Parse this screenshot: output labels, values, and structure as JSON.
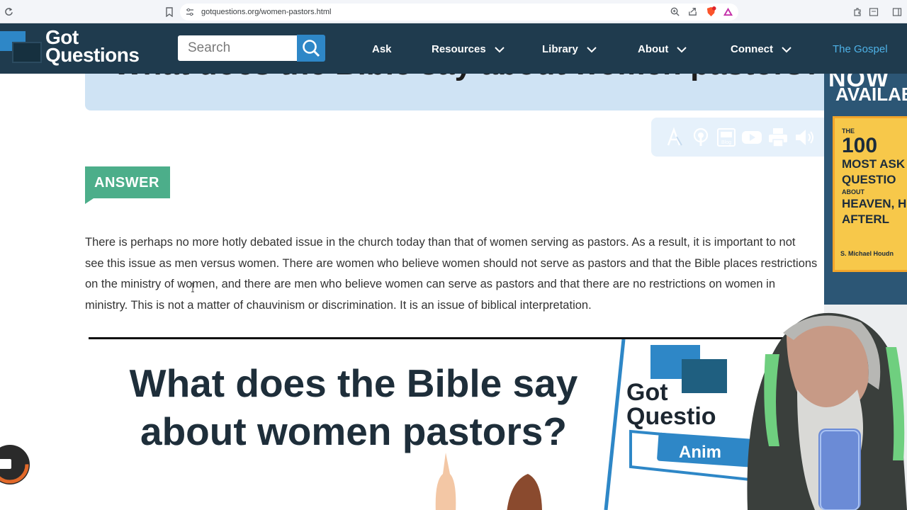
{
  "browser": {
    "url": "gotquestions.org/women-pastors.html"
  },
  "nav": {
    "logo_line1": "Got",
    "logo_line2": "Questions",
    "search_placeholder": "Search",
    "items": [
      {
        "label": "Ask"
      },
      {
        "label": "Resources"
      },
      {
        "label": "Library"
      },
      {
        "label": "About"
      },
      {
        "label": "Connect"
      }
    ],
    "gospel_label": "The Gospel"
  },
  "article": {
    "title": "What does the Bible say about women pastors?",
    "answer_label": "ANSWER",
    "paragraph_lines": [
      "There is perhaps no more hotly debated issue in the church today than that of women serving as pastors. As a result, it is important to not",
      "see this issue as men versus women. There are women who believe women should not serve as pastors and that the Bible places restrictions",
      "on the ministry of women, and there are men who believe women can serve as pastors and that there are no restrictions on women in",
      "ministry. This is not a matter of chauvinism or discrimination. It is an issue of biblical interpretation."
    ]
  },
  "video": {
    "title_line1": "What does the Bible say",
    "title_line2": "about women pastors?",
    "brand_line1": "Got",
    "brand_line2": "Questio",
    "banner": "Anim"
  },
  "ad": {
    "now": "NOW",
    "available": "AVAILAB",
    "book_line1": "THE",
    "book_line2": "100",
    "book_line3": "MOST ASK",
    "book_line4": "QUESTIO",
    "book_line5": "ABOUT",
    "book_line6": "HEAVEN, H",
    "book_line7": "AFTERL",
    "author": "S. Michael Houdn"
  },
  "colors": {
    "nav_bg": "#1f3b4e",
    "search_button": "#2e87c7",
    "answer_tag": "#4cae8a",
    "title_box": "#cfe3f4",
    "gospel_link": "#4fb3e8"
  }
}
